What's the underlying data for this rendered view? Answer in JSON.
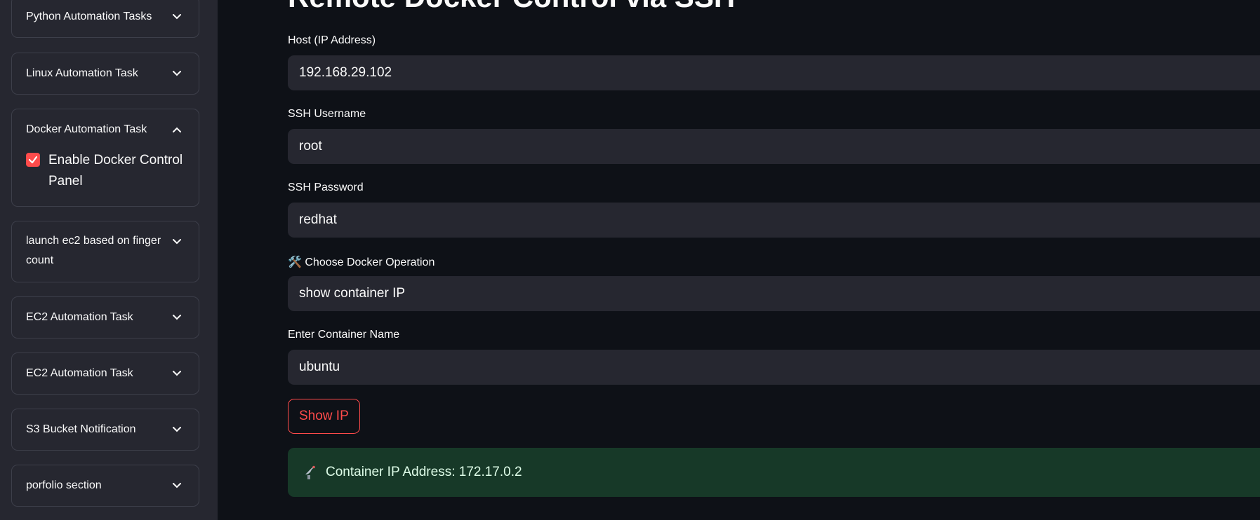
{
  "sidebar": {
    "expanders": [
      {
        "label": "Python Automation Tasks",
        "expanded": false
      },
      {
        "label": "Linux Automation Task",
        "expanded": false
      },
      {
        "label": "Docker Automation Task",
        "expanded": true,
        "checkbox": {
          "label": "Enable Docker Control Panel",
          "checked": true
        }
      },
      {
        "label": "launch ec2 based on finger count",
        "expanded": false
      },
      {
        "label": "EC2 Automation Task",
        "expanded": false
      },
      {
        "label": "EC2 Automation Task",
        "expanded": false
      },
      {
        "label": "S3 Bucket Notification",
        "expanded": false
      },
      {
        "label": "porfolio section",
        "expanded": false
      }
    ]
  },
  "main": {
    "title": "Remote Docker Control via SSH",
    "host": {
      "label": "Host (IP Address)",
      "value": "192.168.29.102"
    },
    "username": {
      "label": "SSH Username",
      "value": "root"
    },
    "password": {
      "label": "SSH Password",
      "value": "redhat"
    },
    "operation": {
      "label": "🛠️ Choose Docker Operation",
      "value": "show container IP"
    },
    "container": {
      "label": "Enter Container Name",
      "value": "ubuntu"
    },
    "button_label": "Show IP",
    "result": {
      "icon": "satellite-antenna-icon",
      "text": "Container IP Address: 172.17.0.2"
    }
  },
  "colors": {
    "accent": "#ff4b4b",
    "background": "#0e1117",
    "sidebar": "#262730",
    "success_bg": "#173928"
  }
}
